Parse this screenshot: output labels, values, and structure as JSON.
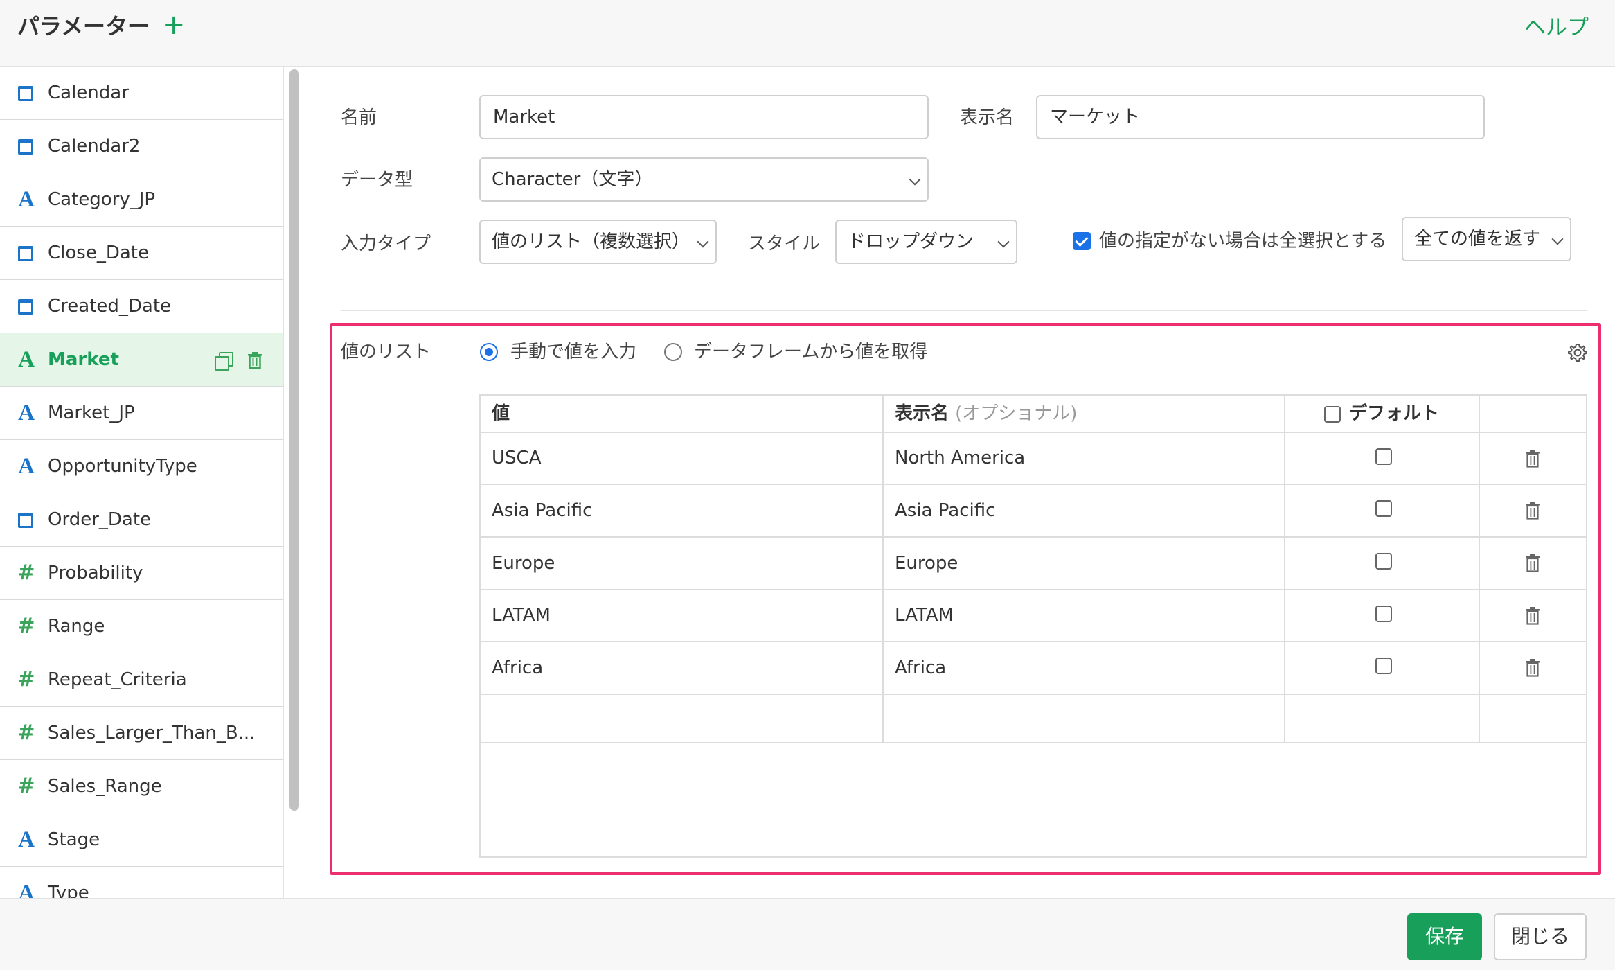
{
  "header": {
    "title": "パラメーター",
    "add_symbol": "+",
    "help": "ヘルプ"
  },
  "sidebar": {
    "items": [
      {
        "label": "Calendar",
        "icon": "calendar-icon"
      },
      {
        "label": "Calendar2",
        "icon": "calendar-icon"
      },
      {
        "label": "Category_JP",
        "icon": "character-type-icon"
      },
      {
        "label": "Close_Date",
        "icon": "calendar-icon"
      },
      {
        "label": "Created_Date",
        "icon": "calendar-icon"
      },
      {
        "label": "Market",
        "icon": "character-type-icon",
        "active": true
      },
      {
        "label": "Market_JP",
        "icon": "character-type-icon"
      },
      {
        "label": "OpportunityType",
        "icon": "character-type-icon"
      },
      {
        "label": "Order_Date",
        "icon": "calendar-icon"
      },
      {
        "label": "Probability",
        "icon": "numeric-type-icon"
      },
      {
        "label": "Range",
        "icon": "numeric-type-icon"
      },
      {
        "label": "Repeat_Criteria",
        "icon": "numeric-type-icon"
      },
      {
        "label": "Sales_Larger_Than_B...",
        "icon": "numeric-type-icon"
      },
      {
        "label": "Sales_Range",
        "icon": "numeric-type-icon"
      },
      {
        "label": "Stage",
        "icon": "character-type-icon"
      },
      {
        "label": "Type",
        "icon": "character-type-icon"
      }
    ]
  },
  "form": {
    "name_label": "名前",
    "name_value": "Market",
    "display_name_label": "表示名",
    "display_name_value": "マーケット",
    "data_type_label": "データ型",
    "data_type_value": "Character（文字）",
    "input_type_label": "入力タイプ",
    "input_type_value": "値のリスト（複数選択）",
    "style_label": "スタイル",
    "style_value": "ドロップダウン",
    "select_all_checked": true,
    "select_all_label": "値の指定がない場合は全選択とする",
    "return_value": "全ての値を返す"
  },
  "value_list": {
    "label": "値のリスト",
    "source_options": [
      {
        "label": "手動で値を入力",
        "selected": true
      },
      {
        "label": "データフレームから値を取得",
        "selected": false
      }
    ],
    "columns": {
      "value": "値",
      "display_name": "表示名",
      "display_name_hint": "(オプショナル)",
      "default": "デフォルト"
    },
    "rows": [
      {
        "value": "USCA",
        "display_name": "North America",
        "default": false
      },
      {
        "value": "Asia Pacific",
        "display_name": "Asia Pacific",
        "default": false
      },
      {
        "value": "Europe",
        "display_name": "Europe",
        "default": false
      },
      {
        "value": "LATAM",
        "display_name": "LATAM",
        "default": false
      },
      {
        "value": "Africa",
        "display_name": "Africa",
        "default": false
      }
    ]
  },
  "footer": {
    "save": "保存",
    "close": "閉じる"
  },
  "colors": {
    "accent_green": "#18a05a",
    "highlight_pink": "#ec2d6e",
    "checkbox_blue": "#1b72e8",
    "type_icon_blue": "#1b74c7"
  }
}
